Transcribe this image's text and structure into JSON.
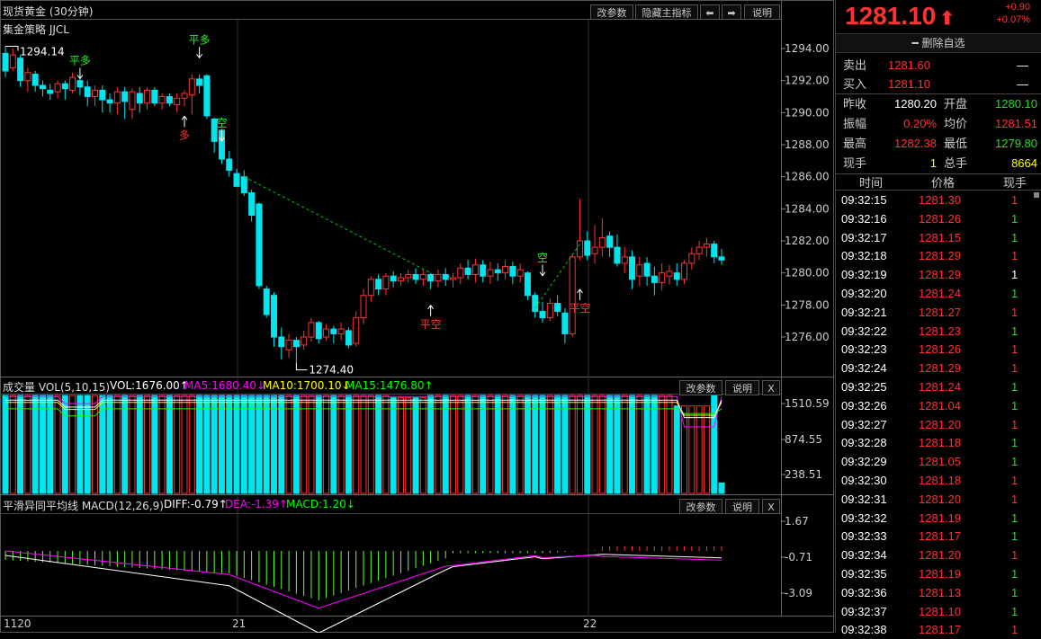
{
  "chart": {
    "title": "现货黄金 (30分钟)",
    "strategy_label": "集金策略 JJCL",
    "buttons": {
      "params": "改参数",
      "hide_main": "隐藏主指标",
      "prev": "⬅",
      "next": "➡",
      "help": "说明"
    },
    "price_ticks": [
      "1294.00",
      "1292.00",
      "1290.00",
      "1288.00",
      "1286.00",
      "1284.00",
      "1282.00",
      "1280.00",
      "1278.00",
      "1276.00"
    ],
    "high_marker": "1294.14",
    "low_marker": "1274.40",
    "signals": [
      {
        "text": "平多"
      },
      {
        "text": "平多"
      },
      {
        "text": "多"
      },
      {
        "text": "空"
      },
      {
        "text": "平空"
      },
      {
        "text": "空"
      },
      {
        "text": "平空"
      }
    ]
  },
  "volume": {
    "title": "成交量 VOL(5,10,15)",
    "vol": "VOL:1676.00↑",
    "ma5": "MA5:1680.40↓",
    "ma10": "MA10:1700.10↓",
    "ma15": "MA15:1476.80↑",
    "ticks": [
      "1510.59",
      "874.55",
      "238.51"
    ],
    "buttons": {
      "params": "改参数",
      "help": "说明",
      "close": "X"
    }
  },
  "macd": {
    "title": "平滑异同平均线 MACD(12,26,9)",
    "diff": "DIFF:-0.79↑",
    "dea": "DEA:-1.39↑",
    "macd": "MACD:1.20↓",
    "ticks": [
      "1.67",
      "-0.71",
      "-3.09"
    ],
    "buttons": {
      "params": "改参数",
      "help": "说明",
      "close": "X"
    }
  },
  "xaxis": [
    "1120",
    "21",
    "22"
  ],
  "colors": {
    "up": "#ff3232",
    "down": "#00e5ee",
    "ma_white": "#ffffff",
    "ma_magenta": "#ff00ff",
    "ma_yellow": "#ffff00",
    "ma_green": "#00ff00"
  },
  "chart_data": {
    "type": "candlestick",
    "title": "现货黄金 (30分钟)",
    "ylim": [
      1274,
      1295
    ],
    "candles": [
      {
        "o": 1293.7,
        "c": 1292.6,
        "h": 1294.14,
        "l": 1292.2
      },
      {
        "o": 1292.8,
        "c": 1293.6,
        "h": 1294.0,
        "l": 1292.6
      },
      {
        "o": 1293.4,
        "c": 1292.0,
        "h": 1293.6,
        "l": 1291.6
      },
      {
        "o": 1292.0,
        "c": 1292.5,
        "h": 1292.8,
        "l": 1291.3
      },
      {
        "o": 1292.4,
        "c": 1291.7,
        "h": 1292.6,
        "l": 1291.3
      },
      {
        "o": 1291.7,
        "c": 1291.5,
        "h": 1292.0,
        "l": 1291.0
      },
      {
        "o": 1291.4,
        "c": 1291.2,
        "h": 1291.8,
        "l": 1290.8
      },
      {
        "o": 1291.3,
        "c": 1291.8,
        "h": 1292.0,
        "l": 1290.9
      },
      {
        "o": 1291.8,
        "c": 1291.5,
        "h": 1292.0,
        "l": 1290.8
      },
      {
        "o": 1291.4,
        "c": 1292.2,
        "h": 1292.5,
        "l": 1291.2
      },
      {
        "o": 1292.0,
        "c": 1291.6,
        "h": 1292.3,
        "l": 1291.1
      },
      {
        "o": 1291.6,
        "c": 1291.0,
        "h": 1292.0,
        "l": 1290.4
      },
      {
        "o": 1291.0,
        "c": 1291.4,
        "h": 1291.7,
        "l": 1290.4
      },
      {
        "o": 1291.4,
        "c": 1290.8,
        "h": 1291.7,
        "l": 1290.0
      },
      {
        "o": 1290.8,
        "c": 1290.6,
        "h": 1291.2,
        "l": 1290.0
      },
      {
        "o": 1290.6,
        "c": 1291.3,
        "h": 1291.6,
        "l": 1289.9
      },
      {
        "o": 1291.3,
        "c": 1290.7,
        "h": 1291.6,
        "l": 1289.6
      },
      {
        "o": 1290.2,
        "c": 1291.3,
        "h": 1291.5,
        "l": 1289.6
      },
      {
        "o": 1291.2,
        "c": 1290.6,
        "h": 1291.6,
        "l": 1290.0
      },
      {
        "o": 1290.6,
        "c": 1291.4,
        "h": 1291.6,
        "l": 1290.2
      },
      {
        "o": 1291.4,
        "c": 1290.6,
        "h": 1291.6,
        "l": 1290.4
      },
      {
        "o": 1290.6,
        "c": 1291.0,
        "h": 1291.2,
        "l": 1290.2
      },
      {
        "o": 1291.0,
        "c": 1290.6,
        "h": 1291.2,
        "l": 1290.4
      },
      {
        "o": 1290.5,
        "c": 1290.9,
        "h": 1291.2,
        "l": 1290.0
      },
      {
        "o": 1290.9,
        "c": 1291.2,
        "h": 1291.4,
        "l": 1290.4
      },
      {
        "o": 1291.1,
        "c": 1292.1,
        "h": 1292.4,
        "l": 1289.9
      },
      {
        "o": 1292.1,
        "c": 1291.7,
        "h": 1292.4,
        "l": 1291.2
      },
      {
        "o": 1292.3,
        "c": 1289.8,
        "h": 1292.4,
        "l": 1289.6
      },
      {
        "o": 1289.6,
        "c": 1288.2,
        "h": 1289.7,
        "l": 1287.5
      },
      {
        "o": 1288.9,
        "c": 1287.1,
        "h": 1289.0,
        "l": 1286.8
      },
      {
        "o": 1287.1,
        "c": 1286.4,
        "h": 1287.6,
        "l": 1286.0
      },
      {
        "o": 1286.2,
        "c": 1285.4,
        "h": 1286.5,
        "l": 1285.6
      },
      {
        "o": 1286.0,
        "c": 1285.0,
        "h": 1286.4,
        "l": 1284.8
      },
      {
        "o": 1285.0,
        "c": 1283.6,
        "h": 1285.2,
        "l": 1283.2
      },
      {
        "o": 1284.3,
        "c": 1279.2,
        "h": 1284.4,
        "l": 1279.0
      },
      {
        "o": 1279.0,
        "c": 1277.4,
        "h": 1279.2,
        "l": 1277.2
      },
      {
        "o": 1278.6,
        "c": 1276.0,
        "h": 1278.8,
        "l": 1275.4
      },
      {
        "o": 1276.0,
        "c": 1275.4,
        "h": 1276.6,
        "l": 1274.6
      },
      {
        "o": 1275.2,
        "c": 1275.8,
        "h": 1276.2,
        "l": 1274.7
      },
      {
        "o": 1275.8,
        "c": 1275.4,
        "h": 1276.0,
        "l": 1274.4
      },
      {
        "o": 1275.5,
        "c": 1276.0,
        "h": 1276.4,
        "l": 1275.2
      },
      {
        "o": 1276.0,
        "c": 1276.9,
        "h": 1277.2,
        "l": 1275.7
      },
      {
        "o": 1276.9,
        "c": 1275.9,
        "h": 1277.0,
        "l": 1275.6
      },
      {
        "o": 1276.0,
        "c": 1276.5,
        "h": 1276.8,
        "l": 1275.8
      },
      {
        "o": 1276.5,
        "c": 1276.2,
        "h": 1276.7,
        "l": 1275.6
      },
      {
        "o": 1276.2,
        "c": 1276.5,
        "h": 1276.9,
        "l": 1275.8
      },
      {
        "o": 1276.4,
        "c": 1275.5,
        "h": 1276.6,
        "l": 1275.3
      },
      {
        "o": 1275.6,
        "c": 1277.2,
        "h": 1277.6,
        "l": 1275.4
      },
      {
        "o": 1277.2,
        "c": 1278.6,
        "h": 1279.0,
        "l": 1276.8
      },
      {
        "o": 1278.6,
        "c": 1279.6,
        "h": 1279.8,
        "l": 1278.2
      },
      {
        "o": 1279.6,
        "c": 1279.0,
        "h": 1279.9,
        "l": 1278.6
      },
      {
        "o": 1279.0,
        "c": 1279.8,
        "h": 1280.0,
        "l": 1278.6
      },
      {
        "o": 1279.8,
        "c": 1279.5,
        "h": 1280.1,
        "l": 1279.1
      },
      {
        "o": 1279.5,
        "c": 1279.7,
        "h": 1280.0,
        "l": 1279.2
      },
      {
        "o": 1279.7,
        "c": 1279.9,
        "h": 1280.2,
        "l": 1279.4
      },
      {
        "o": 1279.9,
        "c": 1279.6,
        "h": 1280.3,
        "l": 1279.3
      },
      {
        "o": 1279.6,
        "c": 1279.9,
        "h": 1280.2,
        "l": 1279.2
      },
      {
        "o": 1279.9,
        "c": 1279.5,
        "h": 1280.0,
        "l": 1279.0
      },
      {
        "o": 1279.5,
        "c": 1279.9,
        "h": 1280.2,
        "l": 1279.1
      },
      {
        "o": 1279.9,
        "c": 1279.6,
        "h": 1280.3,
        "l": 1279.2
      },
      {
        "o": 1279.6,
        "c": 1279.7,
        "h": 1280.0,
        "l": 1279.1
      },
      {
        "o": 1279.7,
        "c": 1280.3,
        "h": 1280.6,
        "l": 1279.3
      },
      {
        "o": 1280.3,
        "c": 1279.9,
        "h": 1280.8,
        "l": 1279.6
      },
      {
        "o": 1279.9,
        "c": 1280.5,
        "h": 1280.9,
        "l": 1279.4
      },
      {
        "o": 1280.5,
        "c": 1279.8,
        "h": 1280.8,
        "l": 1279.4
      },
      {
        "o": 1279.8,
        "c": 1280.2,
        "h": 1280.7,
        "l": 1279.3
      },
      {
        "o": 1280.2,
        "c": 1280.0,
        "h": 1280.6,
        "l": 1279.5
      },
      {
        "o": 1280.0,
        "c": 1280.4,
        "h": 1280.8,
        "l": 1279.6
      },
      {
        "o": 1280.4,
        "c": 1279.8,
        "h": 1280.7,
        "l": 1279.3
      },
      {
        "o": 1279.8,
        "c": 1280.2,
        "h": 1280.6,
        "l": 1279.4
      },
      {
        "o": 1280.0,
        "c": 1278.6,
        "h": 1280.1,
        "l": 1278.3
      },
      {
        "o": 1278.6,
        "c": 1277.6,
        "h": 1278.8,
        "l": 1277.2
      },
      {
        "o": 1277.6,
        "c": 1277.2,
        "h": 1278.2,
        "l": 1276.9
      },
      {
        "o": 1277.2,
        "c": 1278.1,
        "h": 1278.4,
        "l": 1277.0
      },
      {
        "o": 1278.1,
        "c": 1277.6,
        "h": 1278.6,
        "l": 1277.3
      },
      {
        "o": 1277.5,
        "c": 1276.2,
        "h": 1277.8,
        "l": 1275.6
      },
      {
        "o": 1276.2,
        "c": 1281.0,
        "h": 1281.2,
        "l": 1276.0
      },
      {
        "o": 1281.0,
        "c": 1282.0,
        "h": 1284.6,
        "l": 1280.8
      },
      {
        "o": 1282.0,
        "c": 1281.1,
        "h": 1282.6,
        "l": 1280.8
      },
      {
        "o": 1281.2,
        "c": 1281.6,
        "h": 1283.0,
        "l": 1280.6
      },
      {
        "o": 1281.6,
        "c": 1282.2,
        "h": 1283.4,
        "l": 1281.0
      },
      {
        "o": 1282.3,
        "c": 1281.6,
        "h": 1282.6,
        "l": 1281.0
      },
      {
        "o": 1281.6,
        "c": 1280.6,
        "h": 1282.4,
        "l": 1280.4
      },
      {
        "o": 1280.6,
        "c": 1281.0,
        "h": 1281.6,
        "l": 1280.0
      },
      {
        "o": 1281.0,
        "c": 1279.6,
        "h": 1281.4,
        "l": 1279.0
      },
      {
        "o": 1279.8,
        "c": 1280.5,
        "h": 1281.0,
        "l": 1279.2
      },
      {
        "o": 1280.6,
        "c": 1279.8,
        "h": 1281.0,
        "l": 1279.2
      },
      {
        "o": 1279.8,
        "c": 1279.4,
        "h": 1280.4,
        "l": 1278.6
      },
      {
        "o": 1279.4,
        "c": 1280.0,
        "h": 1280.6,
        "l": 1278.9
      },
      {
        "o": 1279.8,
        "c": 1280.1,
        "h": 1280.5,
        "l": 1279.3
      },
      {
        "o": 1280.0,
        "c": 1279.6,
        "h": 1280.6,
        "l": 1279.2
      },
      {
        "o": 1279.6,
        "c": 1280.6,
        "h": 1280.8,
        "l": 1279.3
      },
      {
        "o": 1280.6,
        "c": 1281.2,
        "h": 1281.6,
        "l": 1280.2
      },
      {
        "o": 1281.2,
        "c": 1281.6,
        "h": 1282.0,
        "l": 1280.8
      },
      {
        "o": 1281.6,
        "c": 1281.8,
        "h": 1282.2,
        "l": 1281.0
      },
      {
        "o": 1281.8,
        "c": 1281.0,
        "h": 1282.0,
        "l": 1280.6
      },
      {
        "o": 1281.0,
        "c": 1280.8,
        "h": 1281.5,
        "l": 1280.5
      }
    ]
  },
  "quote": {
    "price": "1281.10",
    "arrow": "⬆",
    "change": "+0.90",
    "change_pct": "+0.07%",
    "delete_btn": "━ 删除自选",
    "sell_label": "卖出",
    "sell_val": "1281.60",
    "sell_qty": "—",
    "buy_label": "买入",
    "buy_val": "1281.10",
    "buy_qty": "—",
    "prev_close_label": "昨收",
    "prev_close": "1280.20",
    "open_label": "开盘",
    "open": "1280.10",
    "amplitude_label": "振幅",
    "amplitude": "0.20%",
    "avg_label": "均价",
    "avg": "1281.51",
    "high_label": "最高",
    "high": "1282.38",
    "low_label": "最低",
    "low": "1279.80",
    "now_label": "现手",
    "now": "1",
    "total_label": "总手",
    "total": "8664",
    "tick_header": {
      "time": "时间",
      "price": "价格",
      "qty": "现手"
    },
    "ticks": [
      {
        "time": "09:32:15",
        "price": "1281.30",
        "qty": "1",
        "qc": "red"
      },
      {
        "time": "09:32:16",
        "price": "1281.26",
        "qty": "1",
        "qc": "green"
      },
      {
        "time": "09:32:17",
        "price": "1281.15",
        "qty": "1",
        "qc": "green"
      },
      {
        "time": "09:32:18",
        "price": "1281.29",
        "qty": "1",
        "qc": "red"
      },
      {
        "time": "09:32:19",
        "price": "1281.29",
        "qty": "1",
        "qc": "white"
      },
      {
        "time": "09:32:20",
        "price": "1281.24",
        "qty": "1",
        "qc": "green"
      },
      {
        "time": "09:32:21",
        "price": "1281.27",
        "qty": "1",
        "qc": "red"
      },
      {
        "time": "09:32:22",
        "price": "1281.23",
        "qty": "1",
        "qc": "green"
      },
      {
        "time": "09:32:23",
        "price": "1281.26",
        "qty": "1",
        "qc": "red"
      },
      {
        "time": "09:32:24",
        "price": "1281.29",
        "qty": "1",
        "qc": "red"
      },
      {
        "time": "09:32:25",
        "price": "1281.24",
        "qty": "1",
        "qc": "green"
      },
      {
        "time": "09:32:26",
        "price": "1281.04",
        "qty": "1",
        "qc": "green"
      },
      {
        "time": "09:32:27",
        "price": "1281.20",
        "qty": "1",
        "qc": "red"
      },
      {
        "time": "09:32:28",
        "price": "1281.18",
        "qty": "1",
        "qc": "green"
      },
      {
        "time": "09:32:29",
        "price": "1281.05",
        "qty": "1",
        "qc": "green"
      },
      {
        "time": "09:32:30",
        "price": "1281.18",
        "qty": "1",
        "qc": "red"
      },
      {
        "time": "09:32:31",
        "price": "1281.20",
        "qty": "1",
        "qc": "red"
      },
      {
        "time": "09:32:32",
        "price": "1281.19",
        "qty": "1",
        "qc": "green"
      },
      {
        "time": "09:32:33",
        "price": "1281.17",
        "qty": "1",
        "qc": "green"
      },
      {
        "time": "09:32:34",
        "price": "1281.20",
        "qty": "1",
        "qc": "red"
      },
      {
        "time": "09:32:35",
        "price": "1281.19",
        "qty": "1",
        "qc": "green"
      },
      {
        "time": "09:32:36",
        "price": "1281.13",
        "qty": "1",
        "qc": "green"
      },
      {
        "time": "09:32:37",
        "price": "1281.10",
        "qty": "1",
        "qc": "green"
      },
      {
        "time": "09:32:38",
        "price": "1281.17",
        "qty": "1",
        "qc": "red"
      }
    ]
  }
}
